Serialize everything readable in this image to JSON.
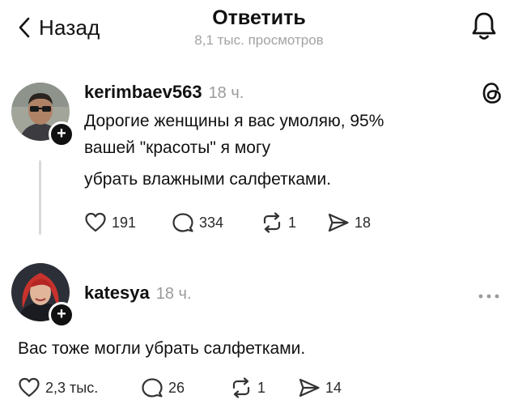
{
  "header": {
    "back_label": "Назад",
    "title": "Ответить",
    "views": "8,1 тыс. просмотров"
  },
  "post": {
    "username": "kerimbaev563",
    "time": "18 ч.",
    "lines": [
      "Дорогие женщины я вас умоляю, 95%",
      "вашей \"красоты\" я могу",
      "убрать влажными салфетками."
    ],
    "likes": "191",
    "comments": "334",
    "reposts": "1",
    "shares": "18"
  },
  "reply": {
    "username": "katesya",
    "time": "18 ч.",
    "text": "Вас тоже могли убрать салфетками.",
    "likes": "2,3 тыс.",
    "comments": "26",
    "reposts": "1",
    "shares": "14"
  },
  "icons": {
    "back": "chevron-left-icon",
    "notifications": "bell-icon",
    "threads": "threads-logo-icon",
    "more": "more-dots-icon",
    "like": "heart-icon",
    "comment": "comment-icon",
    "repost": "repost-icon",
    "share": "send-icon",
    "follow": "plus-icon"
  },
  "colors": {
    "text": "#111111",
    "muted": "#9b9b9b",
    "thread_line": "#d9d9d9",
    "avatar1_bg": "#a2a59a",
    "avatar2_bg": "#2c2f38",
    "avatar2_hair": "#c8322d"
  }
}
